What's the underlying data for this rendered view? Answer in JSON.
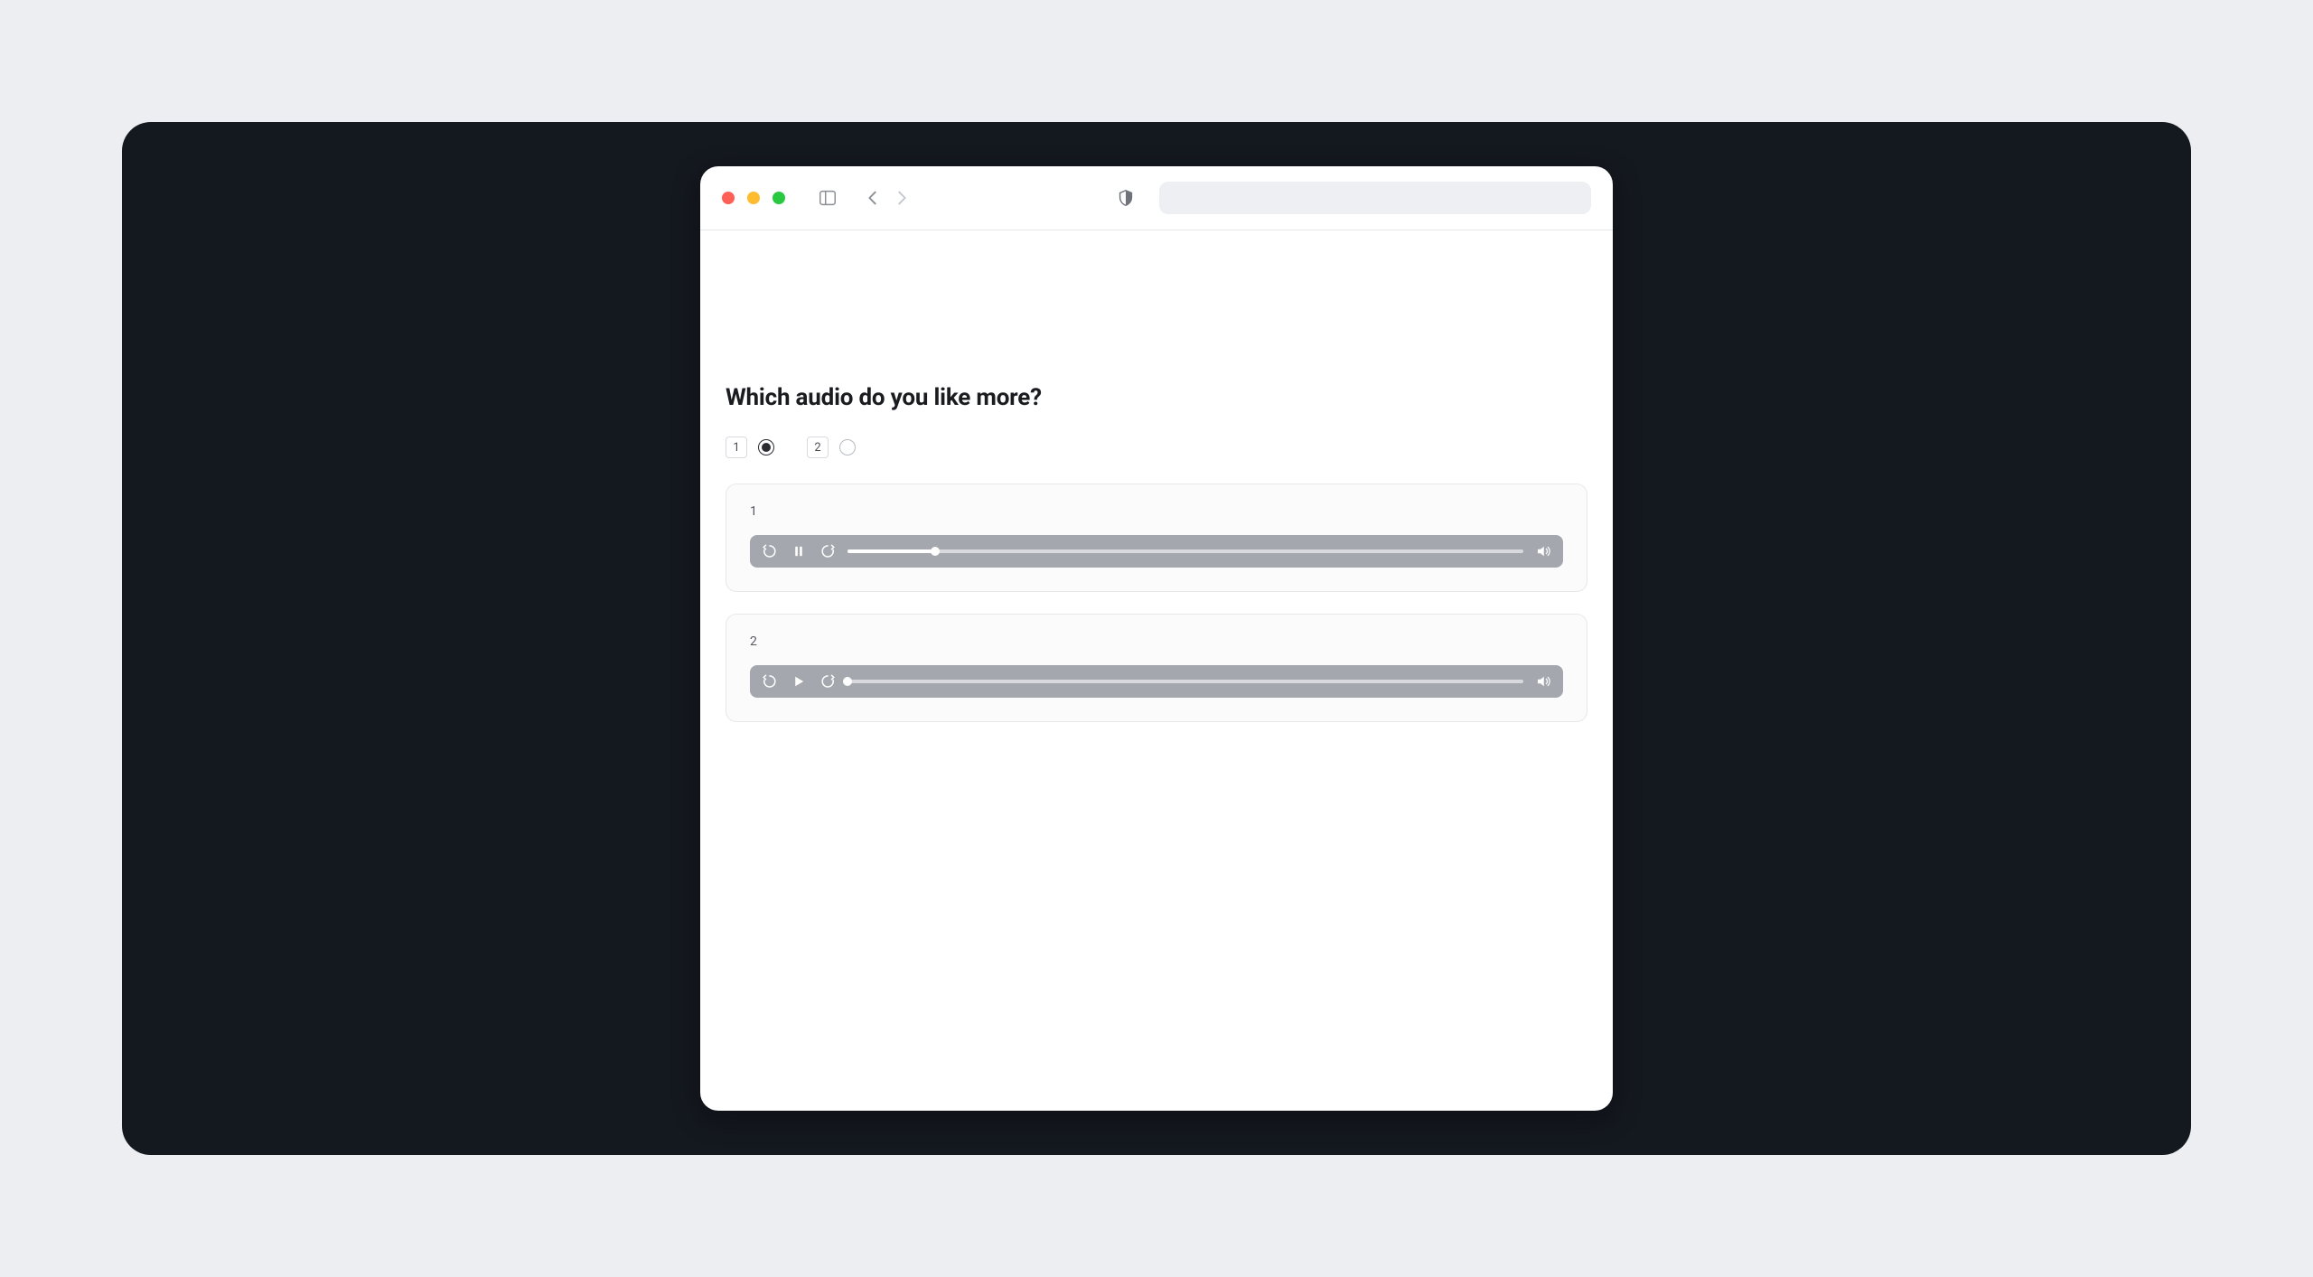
{
  "question": "Which audio do you like more?",
  "choices": {
    "option1": {
      "key": "1",
      "selected": true
    },
    "option2": {
      "key": "2",
      "selected": false
    }
  },
  "players": {
    "p1": {
      "label": "1",
      "state": "playing",
      "progress_percent": 13
    },
    "p2": {
      "label": "2",
      "state": "paused",
      "progress_percent": 0
    }
  },
  "icons": {
    "traffic_close": "close-icon",
    "traffic_min": "minimize-icon",
    "traffic_max": "maximize-icon",
    "sidebar": "sidebar-toggle-icon",
    "back": "chevron-left-icon",
    "forward": "chevron-right-icon",
    "shield": "shield-icon",
    "rewind": "rewind-icon",
    "play": "play-icon",
    "pause": "pause-icon",
    "fastforward": "fastforward-icon",
    "volume": "volume-icon"
  }
}
